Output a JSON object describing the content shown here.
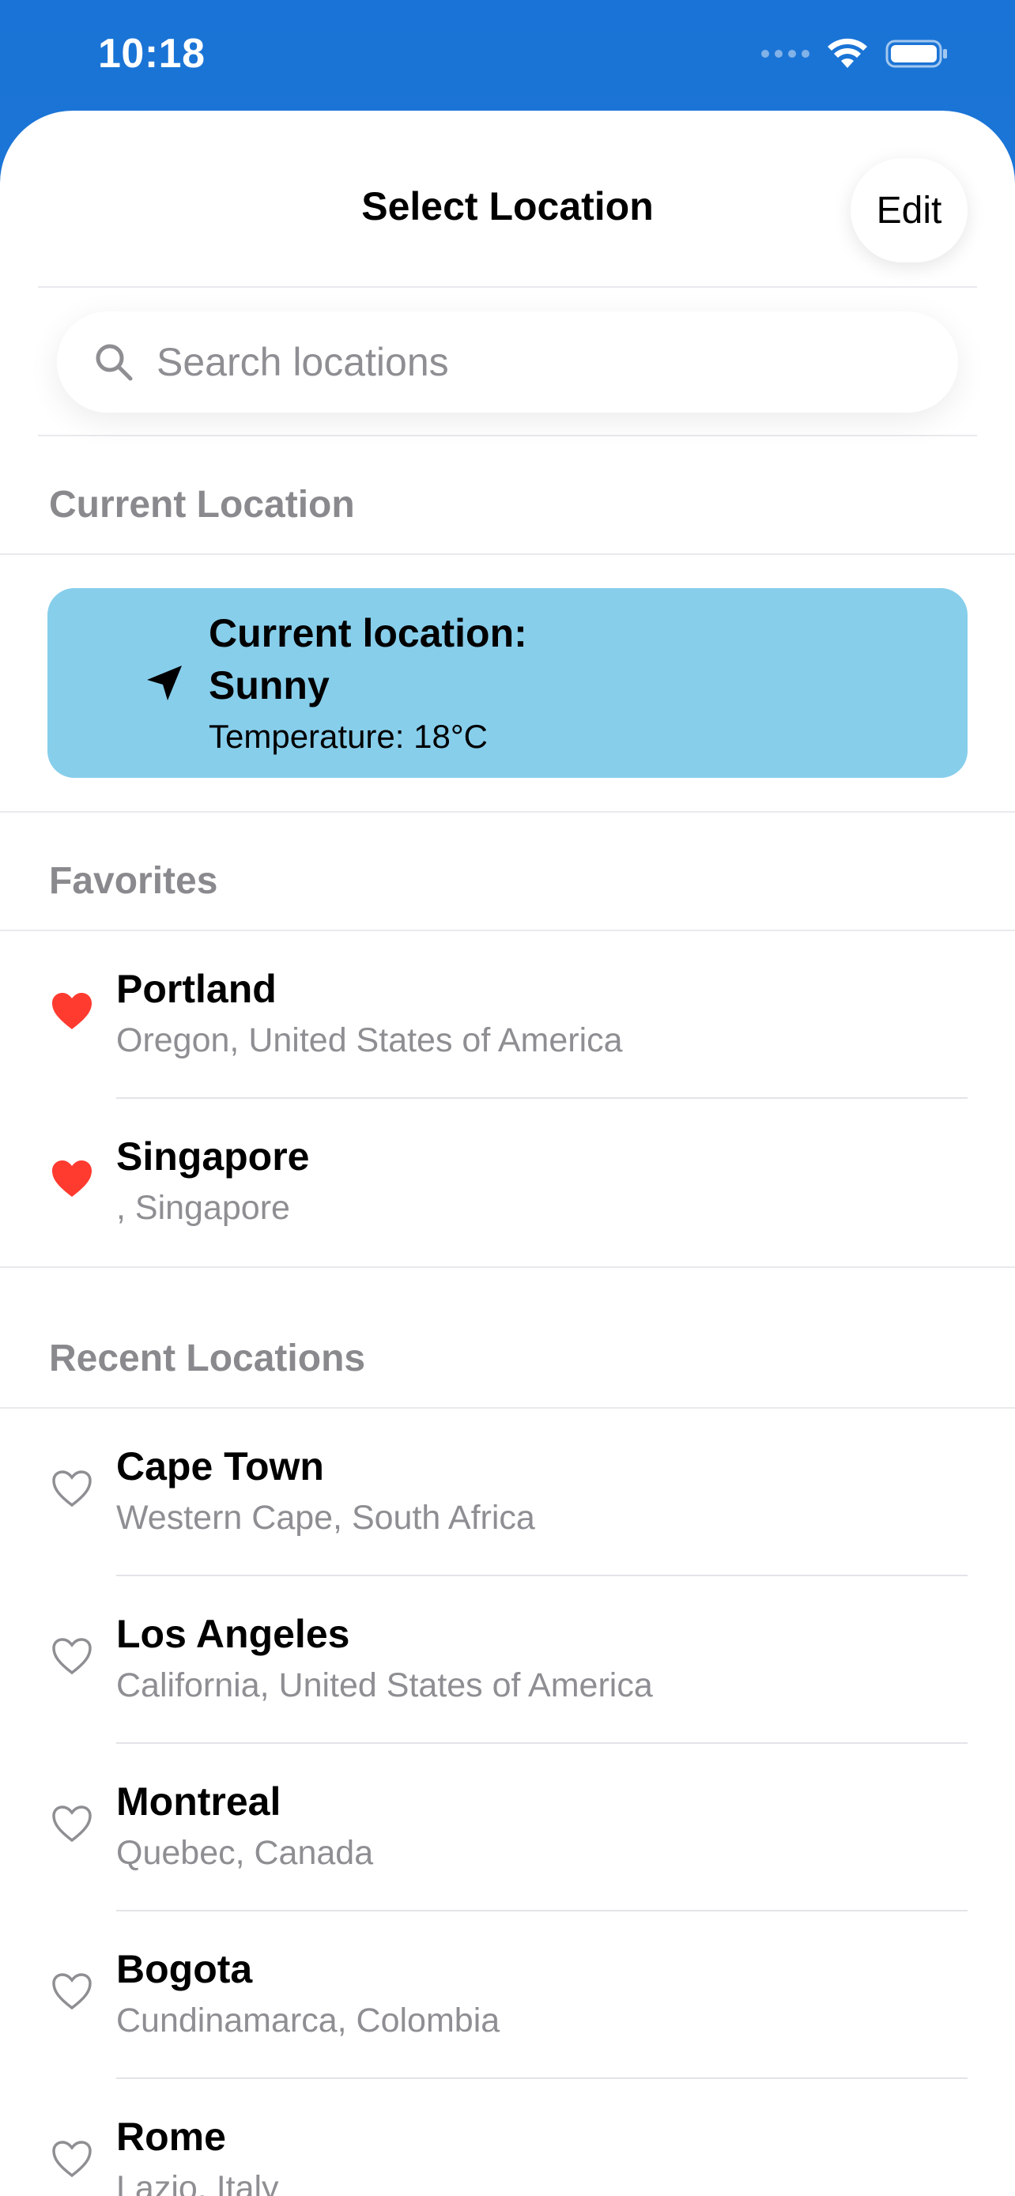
{
  "status_bar": {
    "time": "10:18"
  },
  "header": {
    "title": "Select Location",
    "edit_label": "Edit"
  },
  "search": {
    "placeholder": "Search locations",
    "value": ""
  },
  "current_section": {
    "title": "Current Location",
    "card": {
      "line1": "Current location:",
      "line2": "Sunny",
      "line3": "Temperature: 18°C",
      "color": "#87CEEB"
    }
  },
  "favorites": {
    "title": "Favorites",
    "items": [
      {
        "name": "Portland",
        "region": "Oregon, United States of America",
        "favorite": true
      },
      {
        "name": "Singapore",
        "region": ", Singapore",
        "favorite": true
      }
    ]
  },
  "recent": {
    "title": "Recent Locations",
    "items": [
      {
        "name": "Cape Town",
        "region": "Western Cape, South Africa",
        "favorite": false
      },
      {
        "name": "Los Angeles",
        "region": "California, United States of America",
        "favorite": false
      },
      {
        "name": "Montreal",
        "region": "Quebec, Canada",
        "favorite": false
      },
      {
        "name": "Bogota",
        "region": "Cundinamarca, Colombia",
        "favorite": false
      },
      {
        "name": "Rome",
        "region": "Lazio, Italy",
        "favorite": false
      }
    ]
  },
  "colors": {
    "accent_heart": "#FF3B30",
    "header_gradient": "#1A73D6"
  },
  "icons": {
    "search": "magnifying-glass",
    "current_location": "location-arrow",
    "favorite_on": "heart-filled",
    "favorite_off": "heart-outline"
  }
}
